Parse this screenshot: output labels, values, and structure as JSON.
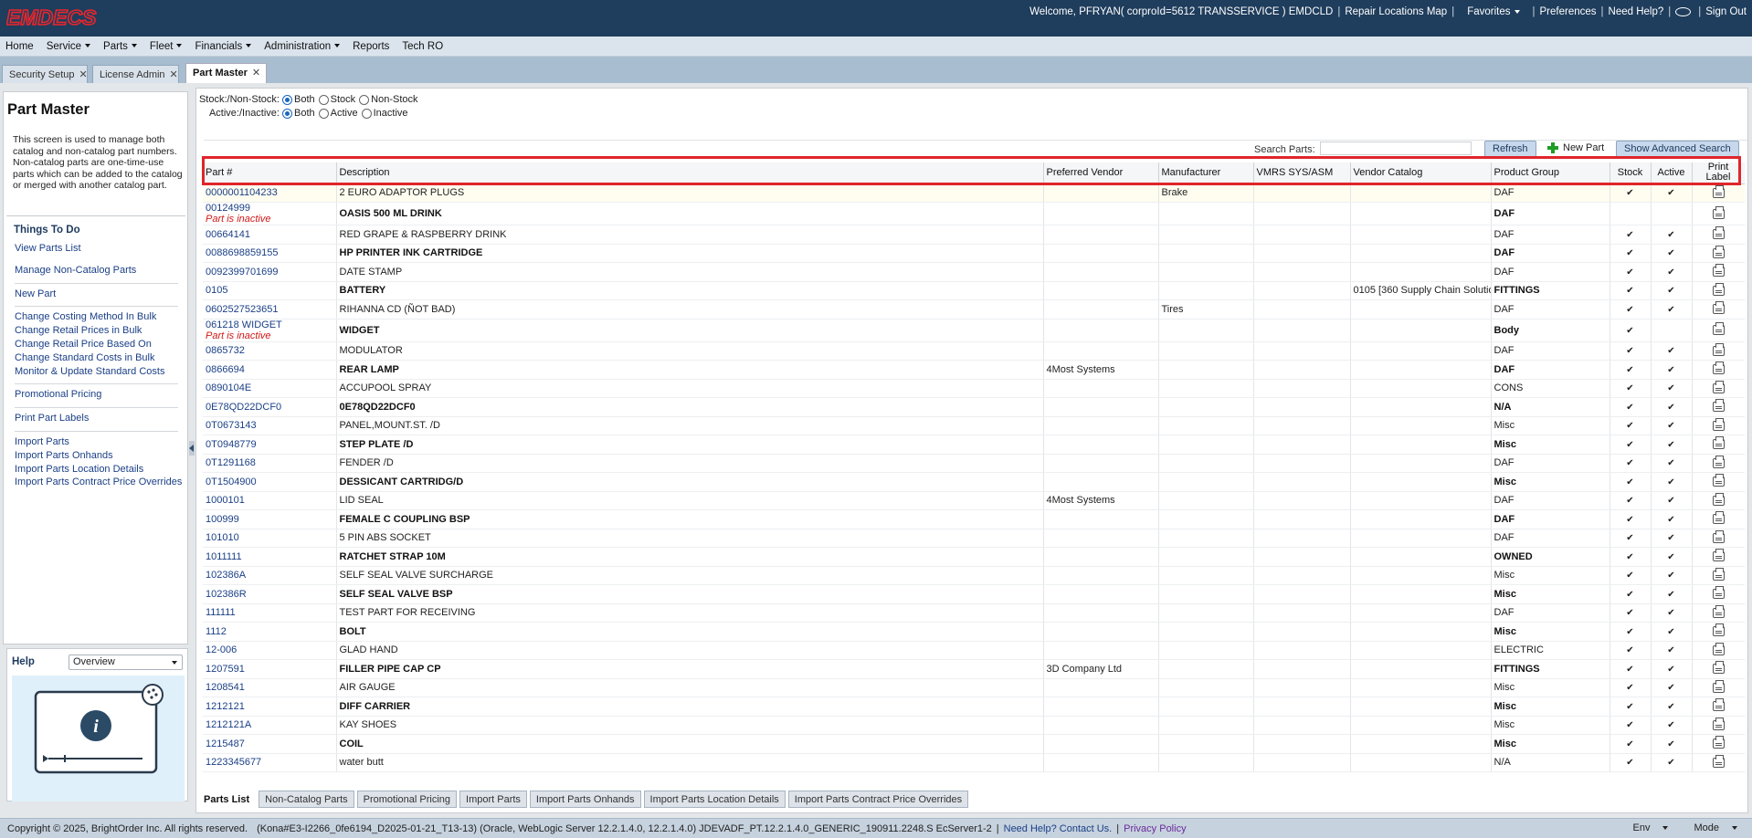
{
  "app": {
    "logo_text": "EMDECS",
    "welcome": "Welcome, PFRYAN( corproId=5612 TRANSSERVICE ) EMDCLD",
    "repair_locations": "Repair Locations Map",
    "favorites": "Favorites",
    "preferences": "Preferences",
    "need_help": "Need Help?",
    "sign_out": "Sign Out"
  },
  "menu": [
    {
      "label": "Home",
      "caret": false
    },
    {
      "label": "Service",
      "caret": true
    },
    {
      "label": "Parts",
      "caret": true
    },
    {
      "label": "Fleet",
      "caret": true
    },
    {
      "label": "Financials",
      "caret": true
    },
    {
      "label": "Administration",
      "caret": true
    },
    {
      "label": "Reports",
      "caret": false
    },
    {
      "label": "Tech RO",
      "caret": false
    }
  ],
  "page_tabs": [
    {
      "label": "Security Setup",
      "active": false
    },
    {
      "label": "License Admin",
      "active": false
    },
    {
      "label": "Part Master",
      "active": true
    }
  ],
  "left": {
    "title": "Part Master",
    "description": "This screen is used to manage both catalog and non-catalog part numbers. Non-catalog parts are one-time-use parts which can be added to the catalog or merged with another catalog part.",
    "todo_title": "Things To Do",
    "groups": [
      [
        "View Parts List",
        "Manage Non-Catalog Parts"
      ],
      [
        "New Part"
      ],
      [
        "Change Costing Method In Bulk",
        "Change Retail Prices in Bulk",
        "Change Retail Price Based On",
        "Change Standard Costs in Bulk",
        "Monitor & Update Standard Costs"
      ],
      [
        "Promotional Pricing"
      ],
      [
        "Print Part Labels"
      ],
      [
        "Import Parts",
        "Import Parts Onhands",
        "Import Parts Location Details",
        "Import Parts Contract Price Overrides"
      ]
    ]
  },
  "help": {
    "title": "Help",
    "selected": "Overview"
  },
  "filters": {
    "stock_label": "Stock:/Non-Stock:",
    "stock_options": [
      "Both",
      "Stock",
      "Non-Stock"
    ],
    "stock_selected": "Both",
    "active_label": "Active:/Inactive:",
    "active_options": [
      "Both",
      "Active",
      "Inactive"
    ],
    "active_selected": "Both"
  },
  "toolbar": {
    "search_label": "Search Parts:",
    "search_value": "",
    "refresh": "Refresh",
    "new_part": "New Part",
    "advanced": "Show Advanced Search"
  },
  "columns": [
    "Part #",
    "Description",
    "Preferred Vendor",
    "Manufacturer",
    "VMRS SYS/ASM",
    "Vendor Catalog",
    "Product Group",
    "Stock",
    "Active",
    "Print Label"
  ],
  "rows": [
    {
      "part": "0000001104233",
      "desc": "2 EURO ADAPTOR PLUGS",
      "vendor": "",
      "mfr": "Brake",
      "vmrs": "",
      "vcat": "",
      "pg": "DAF",
      "stock": true,
      "active": true,
      "bold": false,
      "inactive_note": ""
    },
    {
      "part": "00124999",
      "desc": "OASIS 500 ML DRINK",
      "vendor": "",
      "mfr": "",
      "vmrs": "",
      "vcat": "",
      "pg": "DAF",
      "stock": false,
      "active": false,
      "bold": true,
      "inactive_note": "Part is inactive"
    },
    {
      "part": "00664141",
      "desc": "RED GRAPE & RASPBERRY DRINK",
      "vendor": "",
      "mfr": "",
      "vmrs": "",
      "vcat": "",
      "pg": "DAF",
      "stock": true,
      "active": true,
      "bold": false,
      "inactive_note": ""
    },
    {
      "part": "0088698859155",
      "desc": "HP PRINTER INK CARTRIDGE",
      "vendor": "",
      "mfr": "",
      "vmrs": "",
      "vcat": "",
      "pg": "DAF",
      "stock": true,
      "active": true,
      "bold": true,
      "inactive_note": ""
    },
    {
      "part": "0092399701699",
      "desc": "DATE STAMP",
      "vendor": "",
      "mfr": "",
      "vmrs": "",
      "vcat": "",
      "pg": "DAF",
      "stock": true,
      "active": true,
      "bold": false,
      "inactive_note": ""
    },
    {
      "part": "0105",
      "desc": "BATTERY",
      "vendor": "",
      "mfr": "",
      "vmrs": "",
      "vcat": "0105 [360 Supply Chain Solutio",
      "pg": "FITTINGS",
      "stock": true,
      "active": true,
      "bold": true,
      "inactive_note": ""
    },
    {
      "part": "0602527523651",
      "desc": "RIHANNA CD (ÑOT BAD)",
      "vendor": "",
      "mfr": "Tires",
      "vmrs": "",
      "vcat": "",
      "pg": "DAF",
      "stock": true,
      "active": true,
      "bold": false,
      "inactive_note": ""
    },
    {
      "part": "061218 WIDGET",
      "desc": "WIDGET",
      "vendor": "",
      "mfr": "",
      "vmrs": "",
      "vcat": "",
      "pg": "Body",
      "stock": true,
      "active": false,
      "bold": true,
      "inactive_note": "Part is inactive"
    },
    {
      "part": "0865732",
      "desc": "MODULATOR",
      "vendor": "",
      "mfr": "",
      "vmrs": "",
      "vcat": "",
      "pg": "DAF",
      "stock": true,
      "active": true,
      "bold": false,
      "inactive_note": ""
    },
    {
      "part": "0866694",
      "desc": "REAR LAMP",
      "vendor": "4Most Systems",
      "mfr": "",
      "vmrs": "",
      "vcat": "",
      "pg": "DAF",
      "stock": true,
      "active": true,
      "bold": true,
      "inactive_note": ""
    },
    {
      "part": "0890104E",
      "desc": "ACCUPOOL SPRAY",
      "vendor": "",
      "mfr": "",
      "vmrs": "",
      "vcat": "",
      "pg": "CONS",
      "stock": true,
      "active": true,
      "bold": false,
      "inactive_note": ""
    },
    {
      "part": "0E78QD22DCF0",
      "desc": "0E78QD22DCF0",
      "vendor": "",
      "mfr": "",
      "vmrs": "",
      "vcat": "",
      "pg": "N/A",
      "stock": true,
      "active": true,
      "bold": true,
      "inactive_note": ""
    },
    {
      "part": "0T0673143",
      "desc": "PANEL,MOUNT.ST. /D",
      "vendor": "",
      "mfr": "",
      "vmrs": "",
      "vcat": "",
      "pg": "Misc",
      "stock": true,
      "active": true,
      "bold": false,
      "inactive_note": ""
    },
    {
      "part": "0T0948779",
      "desc": "STEP PLATE /D",
      "vendor": "",
      "mfr": "",
      "vmrs": "",
      "vcat": "",
      "pg": "Misc",
      "stock": true,
      "active": true,
      "bold": true,
      "inactive_note": ""
    },
    {
      "part": "0T1291168",
      "desc": "FENDER /D",
      "vendor": "",
      "mfr": "",
      "vmrs": "",
      "vcat": "",
      "pg": "DAF",
      "stock": true,
      "active": true,
      "bold": false,
      "inactive_note": ""
    },
    {
      "part": "0T1504900",
      "desc": "DESSICANT CARTRIDG/D",
      "vendor": "",
      "mfr": "",
      "vmrs": "",
      "vcat": "",
      "pg": "Misc",
      "stock": true,
      "active": true,
      "bold": true,
      "inactive_note": ""
    },
    {
      "part": "1000101",
      "desc": "LID SEAL",
      "vendor": "4Most Systems",
      "mfr": "",
      "vmrs": "",
      "vcat": "",
      "pg": "DAF",
      "stock": true,
      "active": true,
      "bold": false,
      "inactive_note": ""
    },
    {
      "part": "100999",
      "desc": "FEMALE C COUPLING BSP",
      "vendor": "",
      "mfr": "",
      "vmrs": "",
      "vcat": "",
      "pg": "DAF",
      "stock": true,
      "active": true,
      "bold": true,
      "inactive_note": ""
    },
    {
      "part": "101010",
      "desc": "5 PIN ABS SOCKET",
      "vendor": "",
      "mfr": "",
      "vmrs": "",
      "vcat": "",
      "pg": "DAF",
      "stock": true,
      "active": true,
      "bold": false,
      "inactive_note": ""
    },
    {
      "part": "1011111",
      "desc": "RATCHET STRAP 10M",
      "vendor": "",
      "mfr": "",
      "vmrs": "",
      "vcat": "",
      "pg": "OWNED",
      "stock": true,
      "active": true,
      "bold": true,
      "inactive_note": ""
    },
    {
      "part": "102386A",
      "desc": "SELF SEAL VALVE SURCHARGE",
      "vendor": "",
      "mfr": "",
      "vmrs": "",
      "vcat": "",
      "pg": "Misc",
      "stock": true,
      "active": true,
      "bold": false,
      "inactive_note": ""
    },
    {
      "part": "102386R",
      "desc": "SELF SEAL VALVE BSP",
      "vendor": "",
      "mfr": "",
      "vmrs": "",
      "vcat": "",
      "pg": "Misc",
      "stock": true,
      "active": true,
      "bold": true,
      "inactive_note": ""
    },
    {
      "part": "111111",
      "desc": "TEST PART FOR RECEIVING",
      "vendor": "",
      "mfr": "",
      "vmrs": "",
      "vcat": "",
      "pg": "DAF",
      "stock": true,
      "active": true,
      "bold": false,
      "inactive_note": ""
    },
    {
      "part": "1112",
      "desc": "BOLT",
      "vendor": "",
      "mfr": "",
      "vmrs": "",
      "vcat": "",
      "pg": "Misc",
      "stock": true,
      "active": true,
      "bold": true,
      "inactive_note": ""
    },
    {
      "part": "12-006",
      "desc": "GLAD HAND",
      "vendor": "",
      "mfr": "",
      "vmrs": "",
      "vcat": "",
      "pg": "ELECTRIC",
      "stock": true,
      "active": true,
      "bold": false,
      "inactive_note": ""
    },
    {
      "part": "1207591",
      "desc": "FILLER PIPE CAP CP",
      "vendor": "3D Company Ltd",
      "mfr": "",
      "vmrs": "",
      "vcat": "",
      "pg": "FITTINGS",
      "stock": true,
      "active": true,
      "bold": true,
      "inactive_note": ""
    },
    {
      "part": "1208541",
      "desc": "AIR GAUGE",
      "vendor": "",
      "mfr": "",
      "vmrs": "",
      "vcat": "",
      "pg": "Misc",
      "stock": true,
      "active": true,
      "bold": false,
      "inactive_note": ""
    },
    {
      "part": "1212121",
      "desc": "DIFF CARRIER",
      "vendor": "",
      "mfr": "",
      "vmrs": "",
      "vcat": "",
      "pg": "Misc",
      "stock": true,
      "active": true,
      "bold": true,
      "inactive_note": ""
    },
    {
      "part": "1212121A",
      "desc": "KAY SHOES",
      "vendor": "",
      "mfr": "",
      "vmrs": "",
      "vcat": "",
      "pg": "Misc",
      "stock": true,
      "active": true,
      "bold": false,
      "inactive_note": ""
    },
    {
      "part": "1215487",
      "desc": "COIL",
      "vendor": "",
      "mfr": "",
      "vmrs": "",
      "vcat": "",
      "pg": "Misc",
      "stock": true,
      "active": true,
      "bold": true,
      "inactive_note": ""
    },
    {
      "part": "1223345677",
      "desc": "water butt",
      "vendor": "",
      "mfr": "",
      "vmrs": "",
      "vcat": "",
      "pg": "N/A",
      "stock": true,
      "active": true,
      "bold": false,
      "inactive_note": ""
    }
  ],
  "bottom_tabs": [
    {
      "label": "Parts List",
      "active": true
    },
    {
      "label": "Non-Catalog Parts",
      "active": false
    },
    {
      "label": "Promotional Pricing",
      "active": false
    },
    {
      "label": "Import Parts",
      "active": false
    },
    {
      "label": "Import Parts Onhands",
      "active": false
    },
    {
      "label": "Import Parts Location Details",
      "active": false
    },
    {
      "label": "Import Parts Contract Price Overrides",
      "active": false
    }
  ],
  "footer": {
    "copyright": "Copyright © 2025, BrightOrder Inc. All rights reserved.",
    "build": "(Kona#E3-I2266_0fe6194_D2025-01-21_T13-13) (Oracle, WebLogic Server 12.2.1.4.0, 12.2.1.4.0) JDEVADF_PT.12.2.1.4.0_GENERIC_190911.2248.S EcServer1-2",
    "help_link": "Need Help? Contact Us.",
    "privacy": "Privacy Policy",
    "env": "Env",
    "mode": "Mode"
  },
  "colors": {
    "header_bg": "#1f3d5c",
    "logo": "#e8262d",
    "link": "#1a3f86",
    "inactive_note": "#d01818",
    "highlight_box": "#e0252b"
  }
}
